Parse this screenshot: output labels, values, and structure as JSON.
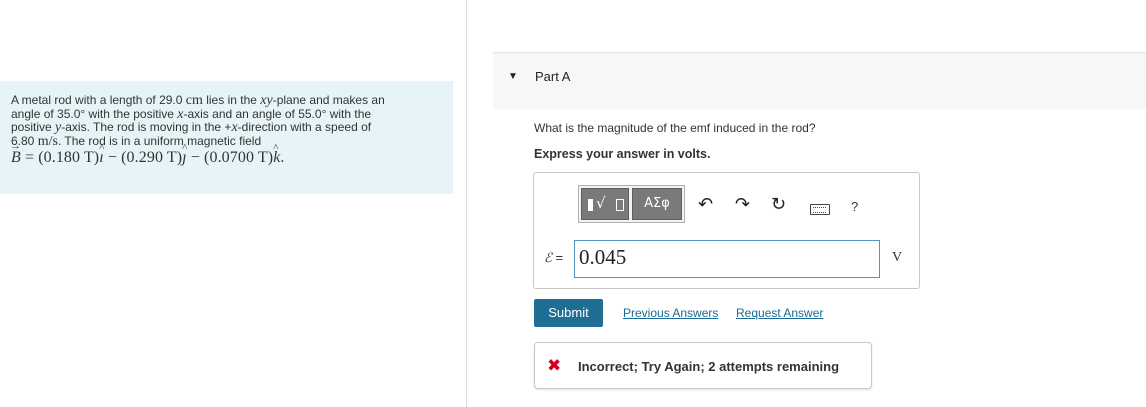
{
  "problem": {
    "line1_a": "A metal rod with a length of 29.0 ",
    "line1_unit": "cm",
    "line1_b": " lies in the ",
    "line1_plane": "xy",
    "line1_c": "-plane and makes an",
    "line2_a": "angle of 35.0° with the positive ",
    "line2_x": "x",
    "line2_b": "-axis and an angle of 55.0° with the",
    "line3_a": "positive ",
    "line3_y": "y",
    "line3_b": "-axis. The rod is moving in the +",
    "line3_x": "x",
    "line3_c": "-direction with a speed of",
    "line4_a": "6.80 ",
    "line4_unit": "m/s",
    "line4_b": ". The rod is in a uniform magnetic field",
    "field_B": "B",
    "field_eq": " = (0.180 T)",
    "field_i": "ı",
    "field_mid1": " − (0.290 T)",
    "field_j": "ȷ",
    "field_mid2": " − (0.0700 T)",
    "field_k": "k",
    "field_end": "."
  },
  "part": {
    "caret_icon": "▼",
    "title": "Part A"
  },
  "question": "What is the magnitude of the emf induced in the rod?",
  "instruction": "Express your answer in volts.",
  "toolbar": {
    "templates_icon": "templates-icon",
    "symbols_label": "ΑΣφ",
    "undo_glyph": "↶",
    "redo_glyph": "↷",
    "reset_glyph": "↻",
    "help_label": "?"
  },
  "answer": {
    "symbol": "ℰ",
    "equals": " =",
    "value": "0.045",
    "unit": "V"
  },
  "actions": {
    "submit": "Submit",
    "previous_answers": "Previous Answers",
    "request_answer": "Request Answer"
  },
  "feedback": {
    "icon": "✖",
    "text": "Incorrect; Try Again; 2 attempts remaining",
    "color": "#d6001c"
  }
}
